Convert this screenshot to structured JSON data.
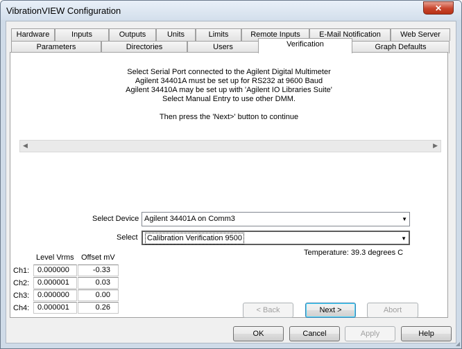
{
  "window": {
    "title": "VibrationVIEW Configuration",
    "close_glyph": "✕"
  },
  "tabs_row1": [
    "Hardware",
    "Inputs",
    "Outputs",
    "Units",
    "Limits",
    "Remote Inputs",
    "E-Mail Notification",
    "Web Server"
  ],
  "tabs_row2": [
    "Parameters",
    "Directories",
    "Users",
    "Verification",
    "Graph Defaults"
  ],
  "instructions": [
    "Select Serial Port connected to the Agilent Digital Multimeter",
    "Agilent 34401A must be set up for RS232 at 9600 Baud",
    "Agilent 34410A may be set up with 'Agilent IO Libraries Suite'",
    "Select Manual Entry to use other DMM.",
    "Then press the 'Next>' button to continue"
  ],
  "device": {
    "label": "Select Device",
    "value": "Agilent 34401A on Comm3"
  },
  "select": {
    "label": "Select",
    "value": "Calibration Verification 9500"
  },
  "temperature": "Temperature: 39.3 degrees C",
  "channel_table": {
    "headers": [
      "Level Vrms",
      "Offset mV"
    ],
    "rows": [
      {
        "ch": "Ch1:",
        "level": "0.000000",
        "offset": "-0.33"
      },
      {
        "ch": "Ch2:",
        "level": "0.000001",
        "offset": "0.03"
      },
      {
        "ch": "Ch3:",
        "level": "0.000000",
        "offset": "0.00"
      },
      {
        "ch": "Ch4:",
        "level": "0.000001",
        "offset": "0.26"
      }
    ]
  },
  "wizard_buttons": {
    "back": "< Back",
    "next": "Next >",
    "abort": "Abort"
  },
  "dialog_buttons": {
    "ok": "OK",
    "cancel": "Cancel",
    "apply": "Apply",
    "help": "Help"
  }
}
